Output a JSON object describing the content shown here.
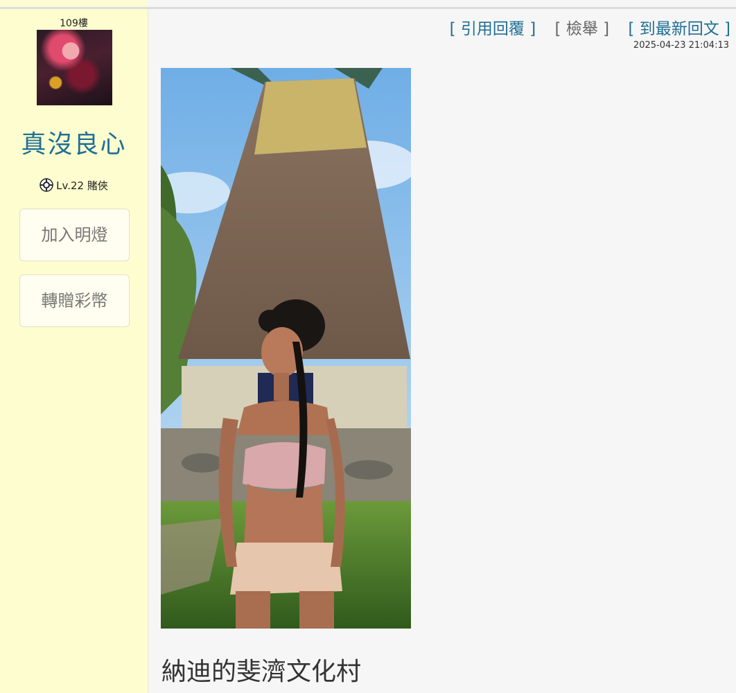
{
  "post": {
    "floor": "109樓",
    "username": "真沒良心",
    "level": "Lv.22 賭俠",
    "buttons": {
      "add_light": "加入明燈",
      "gift_coins": "轉贈彩幣"
    },
    "actions": {
      "quote_reply": "[ 引用回覆 ]",
      "report": "[ 檢舉 ]",
      "latest_reply": "[ 到最新回文 ]"
    },
    "timestamp": "2025-04-23 21:04:13",
    "caption": "納迪的斐濟文化村"
  },
  "icons": {
    "level_badge": "poker-chip-icon"
  },
  "colors": {
    "sidebar_bg": "#fefdcf",
    "link": "#1f6f95",
    "content_bg": "#f6f6f6"
  }
}
